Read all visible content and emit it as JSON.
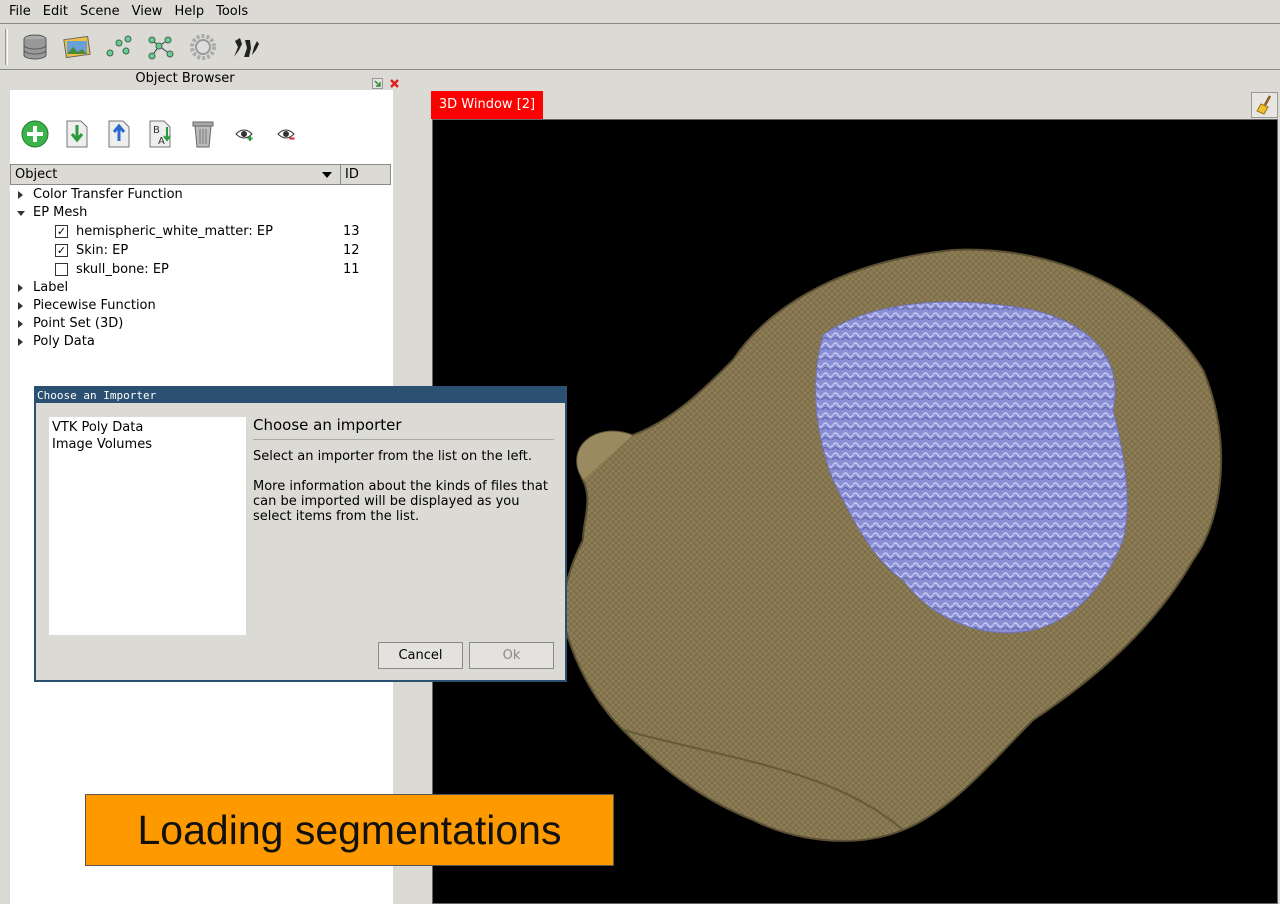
{
  "menu": [
    "File",
    "Edit",
    "Scene",
    "View",
    "Help",
    "Tools"
  ],
  "toolbar_icons": [
    "database-icon",
    "image-icon",
    "points-icon",
    "graph-icon",
    "gear-icon",
    "figures-icon"
  ],
  "object_browser": {
    "title": "Object Browser",
    "tools": [
      "add-icon",
      "import-icon",
      "export-icon",
      "rename-icon",
      "trash-icon",
      "show-icon",
      "hide-icon"
    ],
    "columns": {
      "object": "Object",
      "id": "ID"
    },
    "tree": [
      {
        "label": "Color Transfer Function",
        "expanded": false
      },
      {
        "label": "EP Mesh",
        "expanded": true,
        "children": [
          {
            "label": "hemispheric_white_matter: EP",
            "id": "13",
            "checked": true
          },
          {
            "label": "Skin: EP",
            "id": "12",
            "checked": true
          },
          {
            "label": "skull_bone: EP",
            "id": "11",
            "checked": false
          }
        ]
      },
      {
        "label": "Label",
        "expanded": false
      },
      {
        "label": "Piecewise Function",
        "expanded": false
      },
      {
        "label": "Point Set (3D)",
        "expanded": false
      },
      {
        "label": "Poly Data",
        "expanded": false
      }
    ]
  },
  "view3d": {
    "tab_label": "3D Window [2]",
    "accent": "#ff0000"
  },
  "dialog": {
    "title": "Choose an Importer",
    "importers": [
      "VTK Poly Data",
      "Image Volumes"
    ],
    "heading": "Choose an importer",
    "text1": "Select an importer from the list on the left.",
    "text2": "More information about the kinds of files that can be imported will be displayed as you select items from the list.",
    "cancel": "Cancel",
    "ok": "Ok"
  },
  "banner": {
    "text": "Loading segmentations",
    "color": "#ff9900"
  }
}
